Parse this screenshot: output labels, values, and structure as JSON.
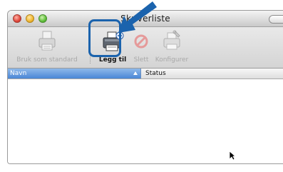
{
  "window": {
    "title": "Skriverliste"
  },
  "toolbar": {
    "items": [
      {
        "label": "Bruk som standard",
        "icon": "printer-default-icon",
        "enabled": false
      },
      {
        "label": "Legg til",
        "icon": "printer-add-icon",
        "enabled": true
      },
      {
        "label": "Slett",
        "icon": "delete-icon",
        "enabled": false
      },
      {
        "label": "Konfigurer",
        "icon": "configure-icon",
        "enabled": false
      }
    ]
  },
  "table": {
    "columns": [
      "Navn",
      "Status"
    ],
    "sort_column": "Navn",
    "sort_direction": "ascending",
    "rows": []
  },
  "annotation": {
    "highlight_color": "#1b63ad",
    "arrow_color": "#1b63ad"
  }
}
